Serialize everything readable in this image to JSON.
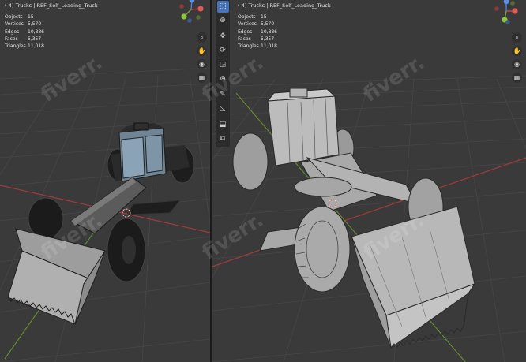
{
  "left_viewport": {
    "header": "(-4) Trucks | REF_Self_Loading_Truck",
    "stats": [
      {
        "label": "Objects",
        "value": "15"
      },
      {
        "label": "Vertices",
        "value": "5,570"
      },
      {
        "label": "Edges",
        "value": "10,886"
      },
      {
        "label": "Faces",
        "value": "5,357"
      },
      {
        "label": "Triangles",
        "value": "11,018"
      }
    ]
  },
  "right_viewport": {
    "header": "(-4) Trucks | REF_Self_Loading_Truck",
    "stats": [
      {
        "label": "Objects",
        "value": "15"
      },
      {
        "label": "Vertices",
        "value": "5,570"
      },
      {
        "label": "Edges",
        "value": "10,886"
      },
      {
        "label": "Faces",
        "value": "5,357"
      },
      {
        "label": "Triangles",
        "value": "11,018"
      }
    ]
  },
  "gizmo": {
    "x": "X",
    "y": "Y",
    "z": "Z"
  },
  "watermark": "fiverr.",
  "colors": {
    "viewport_bg": "#3a3a3a",
    "grid": "#454545",
    "x_axis": "#9c3b3b",
    "y_axis": "#6a8c30",
    "active_tool": "#4772b3",
    "solid_body": "#5f6f7d",
    "clay": "#b7b7b7"
  },
  "nav_icons": [
    "zoom-icon",
    "hand-pan-icon",
    "camera-icon",
    "grid-perspective-icon"
  ],
  "tools": [
    "select-box-icon",
    "cursor-icon",
    "move-icon",
    "rotate-icon",
    "scale-icon",
    "transform-icon",
    "annotate-icon",
    "measure-icon",
    "add-cube-icon",
    "extra-tool-icon"
  ]
}
